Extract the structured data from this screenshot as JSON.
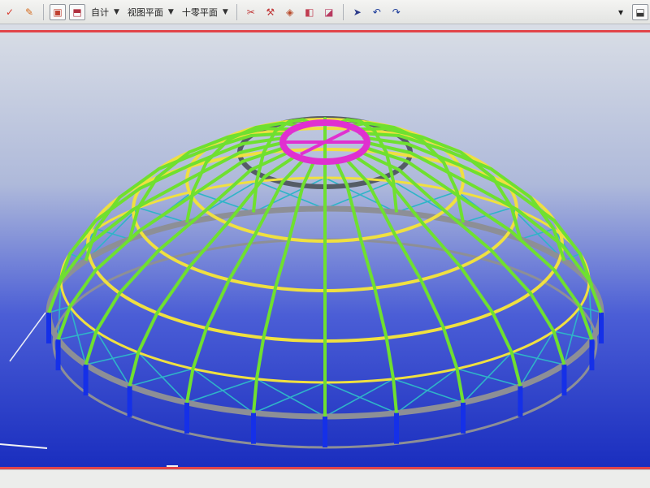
{
  "toolbar": {
    "view_mode": {
      "value": "自计",
      "icon": "chevron-down-icon"
    },
    "projection": {
      "value": "视图平面",
      "icon": "chevron-down-icon"
    },
    "plane": {
      "value": "十零平面",
      "icon": "chevron-down-icon"
    },
    "icons": [
      "check-icon",
      "pencil-icon",
      "layer-icon",
      "pin-icon",
      "scissors-icon",
      "cube-select-icon",
      "cube-edit-icon",
      "cursor-icon",
      "undo-icon",
      "redo-icon",
      "dropdown-icon",
      "expand-icon"
    ]
  },
  "viewport": {
    "model": "dome-frame",
    "colors": {
      "background_top": "#d6dbe4",
      "background_bottom": "#1c2fc4",
      "radial_rib": "#6fe030",
      "ring_outer": "#f0e040",
      "ring_inner": "#555c66",
      "crown": "#e030d0",
      "column": "#1530e8",
      "base_ring": "#8d8f96",
      "brace": "#2fb4c8",
      "accent_rule": "#e2454a"
    }
  }
}
